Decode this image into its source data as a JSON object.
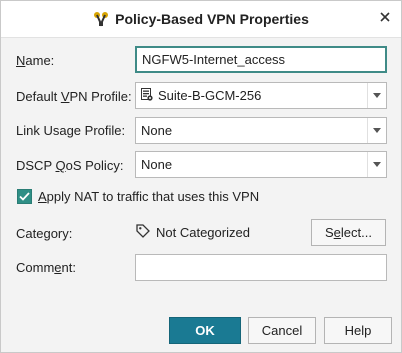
{
  "window": {
    "title": "Policy-Based VPN Properties",
    "title_icon": "policy-vpn-icon",
    "close_icon": "close-icon"
  },
  "form": {
    "name": {
      "label_prefix": "",
      "label_mnemonic": "N",
      "label_rest": "ame:",
      "value": "NGFW5-Internet_access"
    },
    "default_vpn_profile": {
      "label_prefix": "Default ",
      "label_mnemonic": "V",
      "label_rest": "PN Profile:",
      "value": "Suite-B-GCM-256",
      "value_icon": "vpn-profile-icon"
    },
    "link_usage_profile": {
      "label": "Link Usage Profile:",
      "value": "None"
    },
    "dscp_qos_policy": {
      "label_prefix": "DSCP ",
      "label_mnemonic": "Q",
      "label_rest": "oS Policy:",
      "value": "None"
    },
    "apply_nat": {
      "label_prefix": "",
      "label_mnemonic": "A",
      "label_rest": "pply NAT to traffic that uses this VPN",
      "checked": true
    },
    "category": {
      "label": "Category:",
      "value": "Not Categorized",
      "value_icon": "tag-icon",
      "select_button_prefix": "S",
      "select_button_mnemonic": "e",
      "select_button_rest": "lect..."
    },
    "comment": {
      "label_prefix": "Comm",
      "label_mnemonic": "e",
      "label_rest": "nt:",
      "value": ""
    }
  },
  "buttons": {
    "ok": "OK",
    "cancel": "Cancel",
    "help": "Help"
  },
  "colors": {
    "accent_teal": "#2f8f86",
    "primary_button": "#1a7a93",
    "focus_border": "#3f8b87"
  }
}
